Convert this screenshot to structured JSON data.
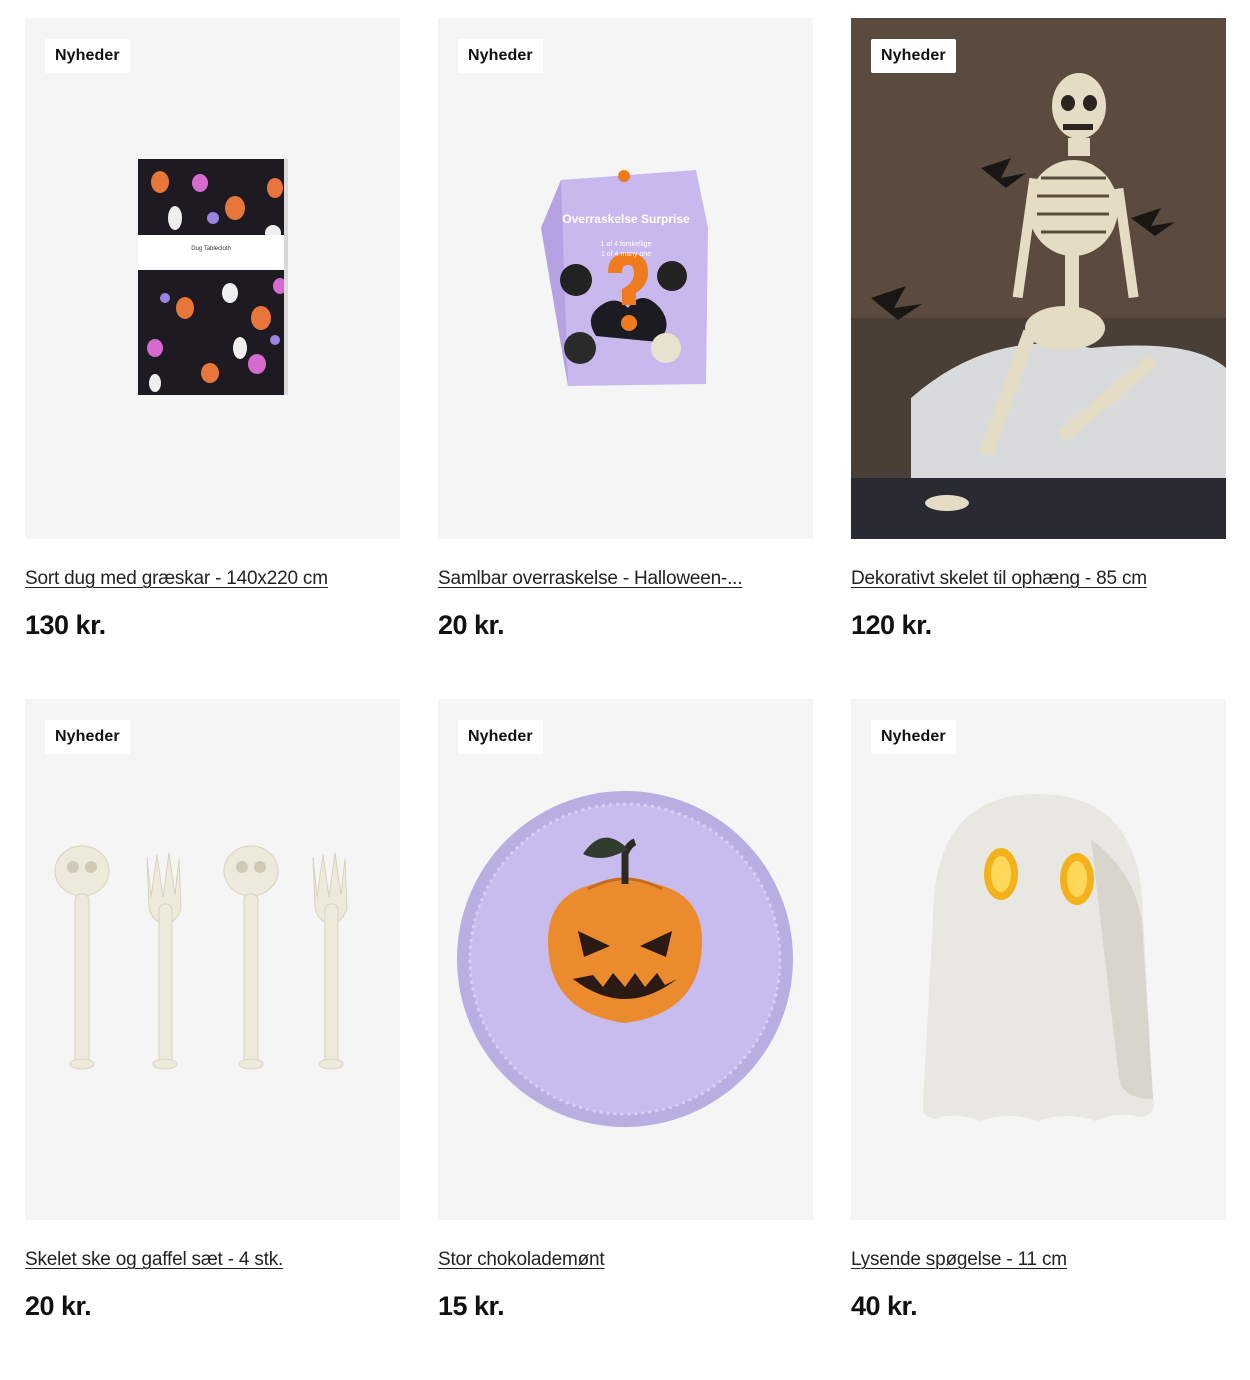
{
  "products": [
    {
      "badge": "Nyheder",
      "name": "Sort dug med græskar - 140x220 cm",
      "price": "130 kr.",
      "box_label": "Dug Tablecloth"
    },
    {
      "badge": "Nyheder",
      "name": "Samlbar overraskelse - Halloween-...",
      "price": "20 kr.",
      "box_title": "Overraskelse Surprise",
      "box_sub1": "1 af 4 forskellige",
      "box_sub2": "1 of 4 many one"
    },
    {
      "badge": "Nyheder",
      "name": "Dekorativt skelet til ophæng - 85 cm",
      "price": "120 kr."
    },
    {
      "badge": "Nyheder",
      "name": "Skelet ske og gaffel sæt - 4 stk.",
      "price": "20 kr."
    },
    {
      "badge": "Nyheder",
      "name": "Stor chokolademønt",
      "price": "15 kr."
    },
    {
      "badge": "Nyheder",
      "name": "Lysende spøgelse - 11 cm",
      "price": "40 kr."
    }
  ],
  "colors": {
    "card_bg": "#f4f5f4",
    "text": "#111111",
    "badge_bg": "#ffffff"
  }
}
